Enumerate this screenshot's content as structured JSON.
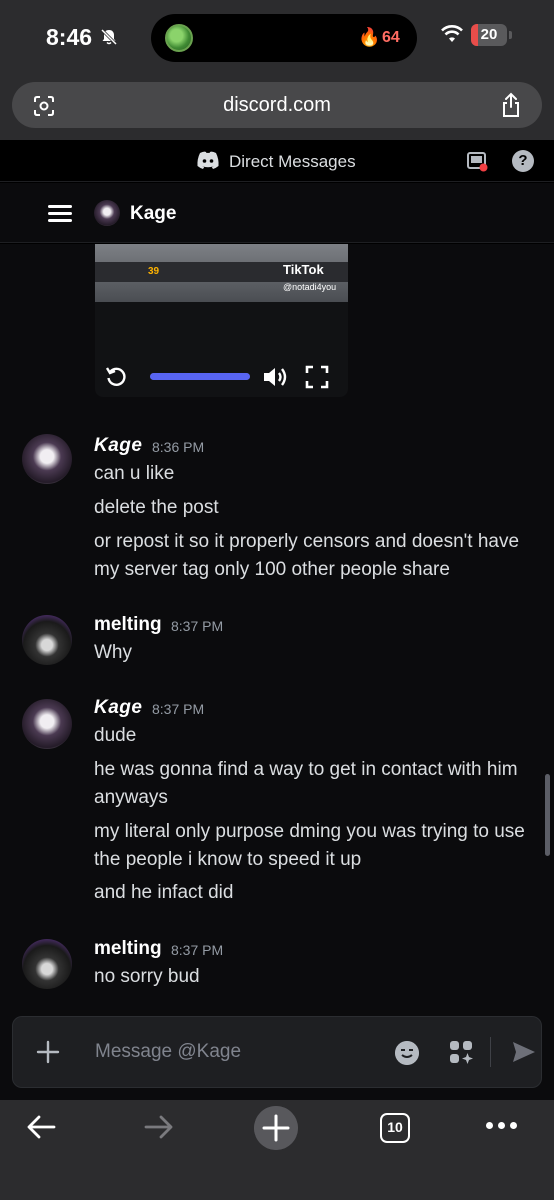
{
  "status_bar": {
    "time": "8:46",
    "streak": "64",
    "battery": "20",
    "battery_level": 0.2
  },
  "browser": {
    "url": "discord.com",
    "tab_count": "10"
  },
  "discord": {
    "header_title": "Direct Messages",
    "help_glyph": "?",
    "channel_name": "Kage",
    "video": {
      "scoreboard_num": "39",
      "brand": "TikTok",
      "handle": "@notadi4you",
      "progress": 1.0
    },
    "messages": [
      {
        "author": "Kage",
        "time": "8:36 PM",
        "lines": [
          "can u like",
          "delete the post",
          "or repost it so it properly censors and doesn't have my server tag only 100 other people share"
        ]
      },
      {
        "author": "melting",
        "time": "8:37 PM",
        "lines": [
          "Why"
        ]
      },
      {
        "author": "Kage",
        "time": "8:37 PM",
        "lines": [
          "dude",
          "he was gonna find a way to get in contact with him anyways",
          "my literal only purpose dming you was trying to use the people i know to speed it up",
          "and he infact did"
        ]
      },
      {
        "author": "melting",
        "time": "8:37 PM",
        "lines": [
          "no sorry bud"
        ]
      }
    ],
    "composer_placeholder": "Message @Kage"
  },
  "colors": {
    "accent": "#5865f2",
    "battery_low": "#e84d4a",
    "streak": "#ff6d63"
  },
  "icons": [
    "bell-off-icon",
    "wifi-icon",
    "lens-icon",
    "share-icon",
    "discord-logo-icon",
    "inbox-icon",
    "help-icon",
    "hamburger-icon",
    "replay-icon",
    "volume-icon",
    "fullscreen-icon",
    "plus-icon",
    "emoji-icon",
    "apps-icon",
    "send-icon",
    "back-arrow-icon",
    "forward-arrow-icon",
    "new-tab-icon",
    "more-icon"
  ]
}
